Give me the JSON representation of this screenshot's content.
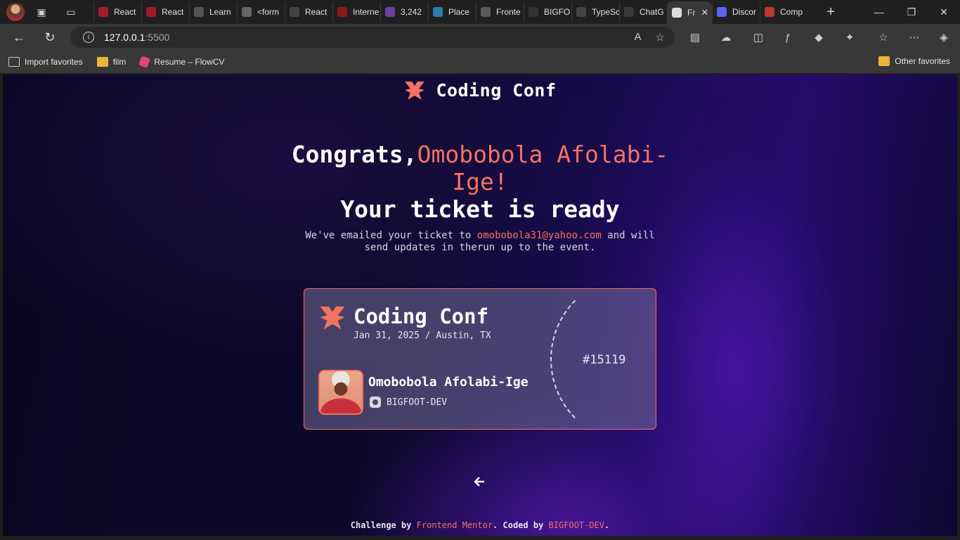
{
  "browser": {
    "tabs": [
      {
        "label": "React",
        "color": "#a01c2c"
      },
      {
        "label": "React",
        "color": "#a01c2c"
      },
      {
        "label": "Learn",
        "color": "#555555"
      },
      {
        "label": "<form",
        "color": "#666666"
      },
      {
        "label": "React",
        "color": "#444444"
      },
      {
        "label": "Interne",
        "color": "#8a1a1a"
      },
      {
        "label": "3,242",
        "color": "#6b3fa0"
      },
      {
        "label": "Place",
        "color": "#2a7fb0"
      },
      {
        "label": "Fronte",
        "color": "#5a5a5a"
      },
      {
        "label": "BIGFO",
        "color": "#333333"
      },
      {
        "label": "TypeSc",
        "color": "#444444"
      },
      {
        "label": "ChatG",
        "color": "#3a3a3a"
      },
      {
        "label": "Fr",
        "color": "#dddddd",
        "active": true
      },
      {
        "label": "Discor",
        "color": "#5865f2"
      },
      {
        "label": "Comp",
        "color": "#c0392b"
      }
    ],
    "address": {
      "host": "127.0.0.1",
      "port": ":5500"
    },
    "favorites": [
      {
        "label": "Import favorites"
      },
      {
        "label": "film"
      },
      {
        "label": "Resume – FlowCV"
      }
    ],
    "other_favorites": "Other favorites"
  },
  "page": {
    "brand": "Coding Conf",
    "headline": {
      "prefix": "Congrats,",
      "name_line1": "Omobobola Afolabi-",
      "name_line2": "Ige!",
      "line3": "Your ticket is ready"
    },
    "sub": {
      "before": "We've emailed your ticket to ",
      "email": "omobobola31@yahoo.com",
      "after_line1": " and will",
      "line2": "send updates in therun up to the event."
    },
    "ticket": {
      "event": "Coding Conf",
      "date": "Jan 31, 2025 / Austin, TX",
      "attendee": "Omobobola Afolabi-Ige",
      "github": "BIGFOOT-DEV",
      "number": "#15119"
    },
    "footer": {
      "t1": "Challenge by ",
      "link1": "Frontend Mentor",
      "t2": ". Coded by ",
      "link2": "BIGFOOT-DEV",
      "t3": "."
    },
    "colors": {
      "accent": "#f57261"
    }
  }
}
